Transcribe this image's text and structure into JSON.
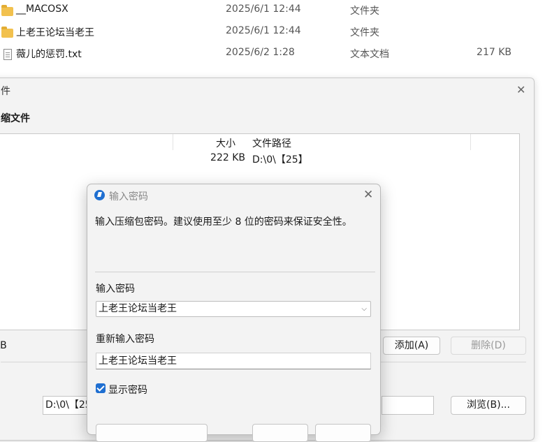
{
  "files": [
    {
      "name": "__MACOSX",
      "date": "2025/6/1 12:44",
      "type": "文件夹",
      "size": "",
      "icon": "folder-icon"
    },
    {
      "name": "上老王论坛当老王",
      "date": "2025/6/1 12:44",
      "type": "文件夹",
      "size": "",
      "icon": "folder-icon"
    },
    {
      "name": "薇儿的惩罚.txt",
      "date": "2025/6/2 1:28",
      "type": "文本文档",
      "size": "217 KB",
      "icon": "text-file-icon"
    }
  ],
  "back_dialog": {
    "title": "件",
    "heading": "缩文件",
    "table": {
      "col_size": "大小",
      "col_path": "文件路径",
      "row_size": "222 KB",
      "row_path": "D:\\0\\【25】"
    },
    "total_size": "KB",
    "add_label": "添加(A)",
    "delete_label": "删除(D)",
    "output_path": "D:\\0\\【25",
    "browse_label": "浏览(B)..."
  },
  "password_dialog": {
    "title": "输入密码",
    "description": "输入压缩包密码。建议使用至少 8 位的密码来保证安全性。",
    "password_label": "输入密码",
    "password_value": "上老王论坛当老王",
    "confirm_label": "重新输入密码",
    "confirm_value": "上老王论坛当老王",
    "show_password_label": "显示密码",
    "show_password_checked": true
  },
  "colors": {
    "accent": "#1f6fd1",
    "folder": "#f2c14e"
  }
}
